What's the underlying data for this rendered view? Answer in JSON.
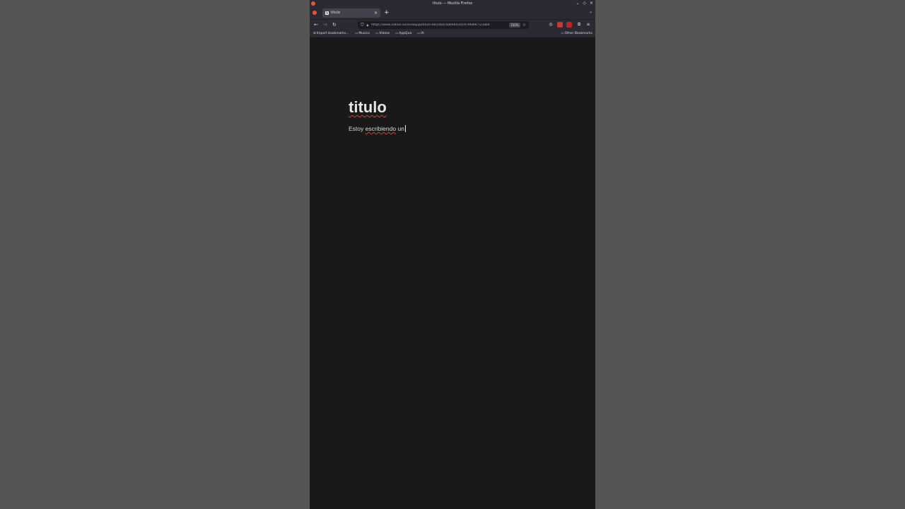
{
  "window": {
    "title": "titulo — Mozilla Firefox"
  },
  "tab": {
    "title": "titulo",
    "favicon": "N"
  },
  "navbar": {
    "url": "https://www.notion.so/sinaepyp/titulo-b61564caab94434197d689c723ab4",
    "zoom": "150%"
  },
  "bookmarks": {
    "items": [
      "Import bookmarks...",
      "Musica",
      "Videos",
      "AppQua",
      "IA"
    ],
    "other": "Other Bookmarks"
  },
  "page": {
    "title": "titulo",
    "text_pre": "Estoy ",
    "text_spell": "escribiendo",
    "text_post": " un"
  },
  "colors": {
    "chrome": "#2b2a33",
    "page_bg": "#191919",
    "spellcheck": "#d43b3b"
  }
}
